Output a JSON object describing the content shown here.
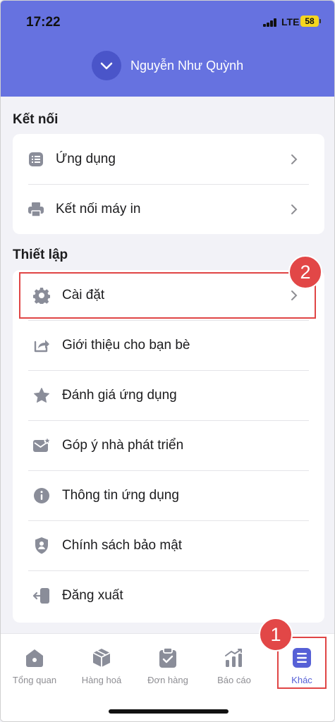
{
  "status_bar": {
    "time": "17:22",
    "network": "LTE",
    "battery": "58"
  },
  "header": {
    "account_name": "Nguyễn Như Quỳnh",
    "background": "#6672e0"
  },
  "sections": [
    {
      "title": "Kết nối",
      "items": [
        {
          "label": "Ứng dụng",
          "icon": "list-icon",
          "chevron": true
        },
        {
          "label": "Kết nối máy in",
          "icon": "printer-icon",
          "chevron": true
        }
      ]
    },
    {
      "title": "Thiết lập",
      "items": [
        {
          "label": "Cài đặt",
          "icon": "gear-icon",
          "chevron": true
        },
        {
          "label": "Giới thiệu cho bạn bè",
          "icon": "share-icon",
          "chevron": false
        },
        {
          "label": "Đánh giá ứng dụng",
          "icon": "star-icon",
          "chevron": false
        },
        {
          "label": "Góp ý nhà phát triển",
          "icon": "feedback-mail-icon",
          "chevron": false
        },
        {
          "label": "Thông tin ứng dụng",
          "icon": "info-icon",
          "chevron": false
        },
        {
          "label": "Chính sách bảo mật",
          "icon": "shield-user-icon",
          "chevron": false
        },
        {
          "label": "Đăng xuất",
          "icon": "logout-icon",
          "chevron": false
        }
      ]
    }
  ],
  "annotations": {
    "badge_1": "1",
    "badge_2": "2",
    "color": "#e24747"
  },
  "tabbar": {
    "tabs": [
      {
        "label": "Tổng quan",
        "icon": "home-icon",
        "active": false
      },
      {
        "label": "Hàng hoá",
        "icon": "box-icon",
        "active": false
      },
      {
        "label": "Đơn hàng",
        "icon": "clipboard-icon",
        "active": false
      },
      {
        "label": "Báo cáo",
        "icon": "chart-icon",
        "active": false
      },
      {
        "label": "Khác",
        "icon": "menu-icon",
        "active": true
      }
    ],
    "accent": "#5660d6"
  }
}
